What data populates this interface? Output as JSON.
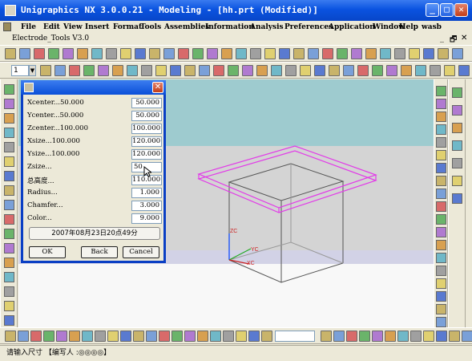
{
  "window": {
    "title": "Unigraphics NX 3.0.0.21 - Modeling - [hh.prt (Modified)]"
  },
  "menu": [
    {
      "label": "File",
      "accel": "F"
    },
    {
      "label": "Edit",
      "accel": "E"
    },
    {
      "label": "View",
      "accel": "V"
    },
    {
      "label": "Insert",
      "accel": "s"
    },
    {
      "label": "Format",
      "accel": "r"
    },
    {
      "label": "Tools",
      "accel": "T"
    },
    {
      "label": "Assemblies",
      "accel": "A"
    },
    {
      "label": "Information",
      "accel": "I"
    },
    {
      "label": "Analysis",
      "accel": "l"
    },
    {
      "label": "Preferences",
      "accel": "P"
    },
    {
      "label": "Application",
      "accel": "n"
    },
    {
      "label": "Window",
      "accel": "o"
    },
    {
      "label": "Help",
      "accel": "H"
    },
    {
      "label": "wasb",
      "accel": ""
    }
  ],
  "electrode_tools": {
    "label": "Electrode_Tools V3.0"
  },
  "layer_select": {
    "value": "1"
  },
  "dialog": {
    "fields": [
      {
        "label": "Xcenter...50.000",
        "value": "50.000"
      },
      {
        "label": "Ycenter...50.000",
        "value": "50.000"
      },
      {
        "label": "Zcenter...100.000",
        "value": "100.000"
      },
      {
        "label": "Xsize...100.000",
        "value": "120.000"
      },
      {
        "label": "Ysize...100.000",
        "value": "120.000"
      },
      {
        "label": "Zsize...",
        "value": "50"
      },
      {
        "label": "总高度...",
        "value": "110.000"
      },
      {
        "label": "Radius...",
        "value": "1.000"
      },
      {
        "label": "Chamfer...",
        "value": "3.000"
      },
      {
        "label": "Color...",
        "value": "9.000"
      }
    ],
    "date_button": "2007年08月23日20点49分",
    "ok_label": "OK",
    "back_label": "Back",
    "cancel_label": "Cancel"
  },
  "axes": {
    "zc": "ZC",
    "yc": "YC",
    "xc": "XC"
  },
  "statusbar": {
    "text": "请输入尺寸    【编写人 :◎◎◎◎】"
  },
  "colors": {
    "title_blue": "#0a53e0",
    "sky": "#9ecbcf",
    "floor": "#d4d4d4",
    "magenta": "#e23be8"
  }
}
